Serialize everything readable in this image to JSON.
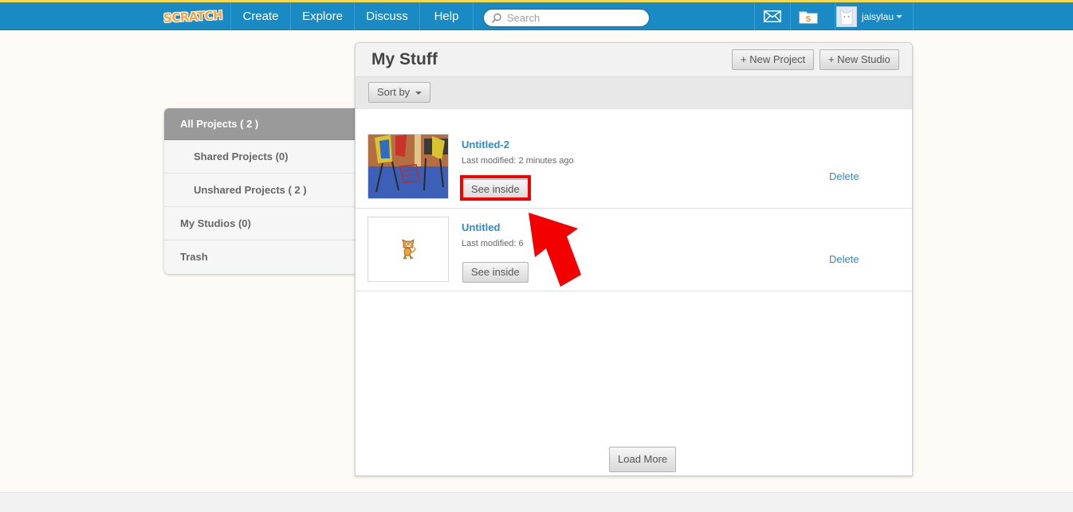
{
  "nav": {
    "logo": "SCRATCH",
    "links": [
      "Create",
      "Explore",
      "Discuss",
      "Help"
    ],
    "search_placeholder": "Search",
    "username": "jaisylau"
  },
  "sidebar": {
    "items": [
      {
        "label": "All Projects ( 2 )",
        "active": true
      },
      {
        "label": "Shared Projects (0)"
      },
      {
        "label": "Unshared Projects ( 2 )"
      },
      {
        "label": "My Studios (0)"
      },
      {
        "label": "Trash"
      }
    ]
  },
  "main": {
    "title": "My Stuff",
    "new_project": "+ New Project",
    "new_studio": "+ New Studio",
    "sort_by": "Sort by",
    "load_more": "Load More",
    "projects": [
      {
        "title": "Untitled-2",
        "modified": "Last modified: 2 minutes ago",
        "see_inside": "See inside",
        "delete": "Delete"
      },
      {
        "title": "Untitled",
        "modified": "Last modified: 6",
        "see_inside": "See inside",
        "delete": "Delete"
      }
    ]
  },
  "icons": [
    "search-icon",
    "messages-icon",
    "my-stuff-icon",
    "dropdown-caret-icon",
    "pointer-arrow-icon"
  ],
  "colors": {
    "nav_bg": "#1a8ac4",
    "link": "#2d8bc9",
    "highlight": "#f30000",
    "logo": "#f9a53b"
  }
}
